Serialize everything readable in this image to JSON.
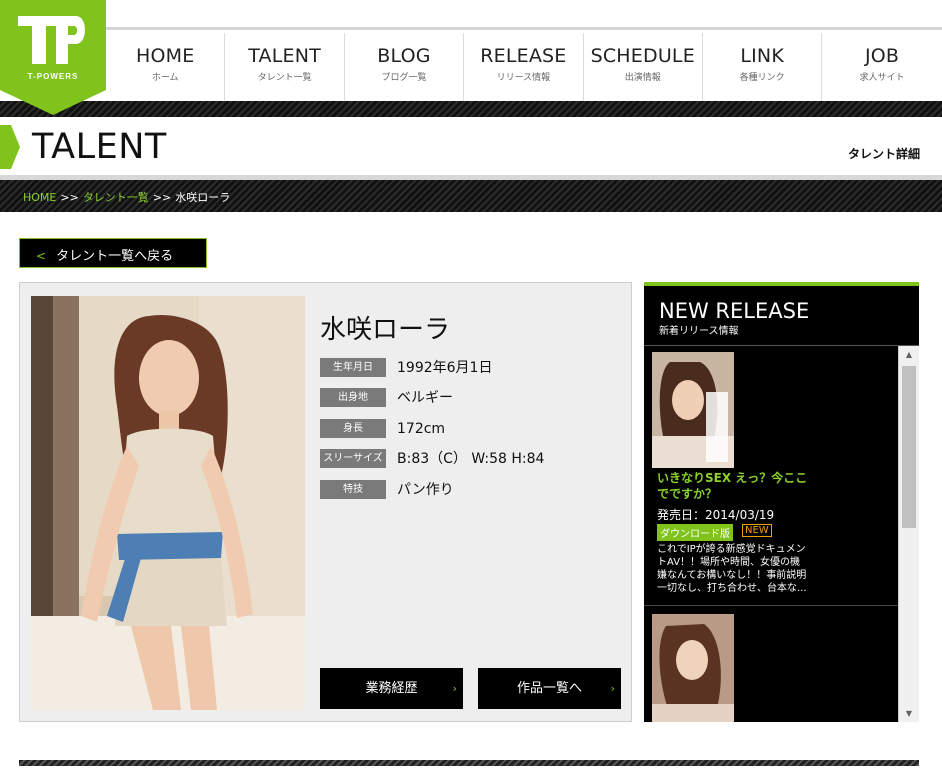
{
  "brand": {
    "logo_text": "T-POWERS",
    "accent": "#7fc31c"
  },
  "nav": [
    {
      "en": "HOME",
      "jp": "ホーム"
    },
    {
      "en": "TALENT",
      "jp": "タレント一覧"
    },
    {
      "en": "BLOG",
      "jp": "ブログ一覧"
    },
    {
      "en": "RELEASE",
      "jp": "リリース情報"
    },
    {
      "en": "SCHEDULE",
      "jp": "出演情報"
    },
    {
      "en": "LINK",
      "jp": "各種リンク"
    },
    {
      "en": "JOB",
      "jp": "求人サイト"
    }
  ],
  "page": {
    "title": "TALENT",
    "subtitle": "タレント詳細"
  },
  "breadcrumb": {
    "home": "HOME",
    "sep": ">>",
    "list": "タレント一覧",
    "current": "水咲ローラ"
  },
  "back": {
    "chevron": "<",
    "label": "タレント一覧へ戻る"
  },
  "profile": {
    "name": "水咲ローラ",
    "attributes": [
      {
        "label": "生年月日",
        "value": "1992年6月1日"
      },
      {
        "label": "出身地",
        "value": "ベルギー"
      },
      {
        "label": "身長",
        "value": "172cm"
      },
      {
        "label": "スリーサイズ",
        "value": "B:83（C） W:58 H:84"
      },
      {
        "label": "特技",
        "value": "パン作り"
      }
    ],
    "buttons": {
      "career": "業務経歴",
      "works": "作品一覧へ",
      "arrow": "›"
    }
  },
  "release": {
    "title": "NEW RELEASE",
    "subtitle": "新着リリース情報",
    "items": [
      {
        "title": "いきなりSEX えっ？今ここでですか？",
        "date": "発売日：2014/03/19",
        "badge": "ダウンロード版",
        "new_label": "NEW",
        "desc": "これでIPが誇る新感覚ドキュメントAV！！場所や時間、女優の機嫌なんてお構いなし！！事前説明一切なし、打ち合わせ、台本な..."
      }
    ]
  },
  "scrollbar": {
    "up": "▲",
    "down": "▼"
  }
}
